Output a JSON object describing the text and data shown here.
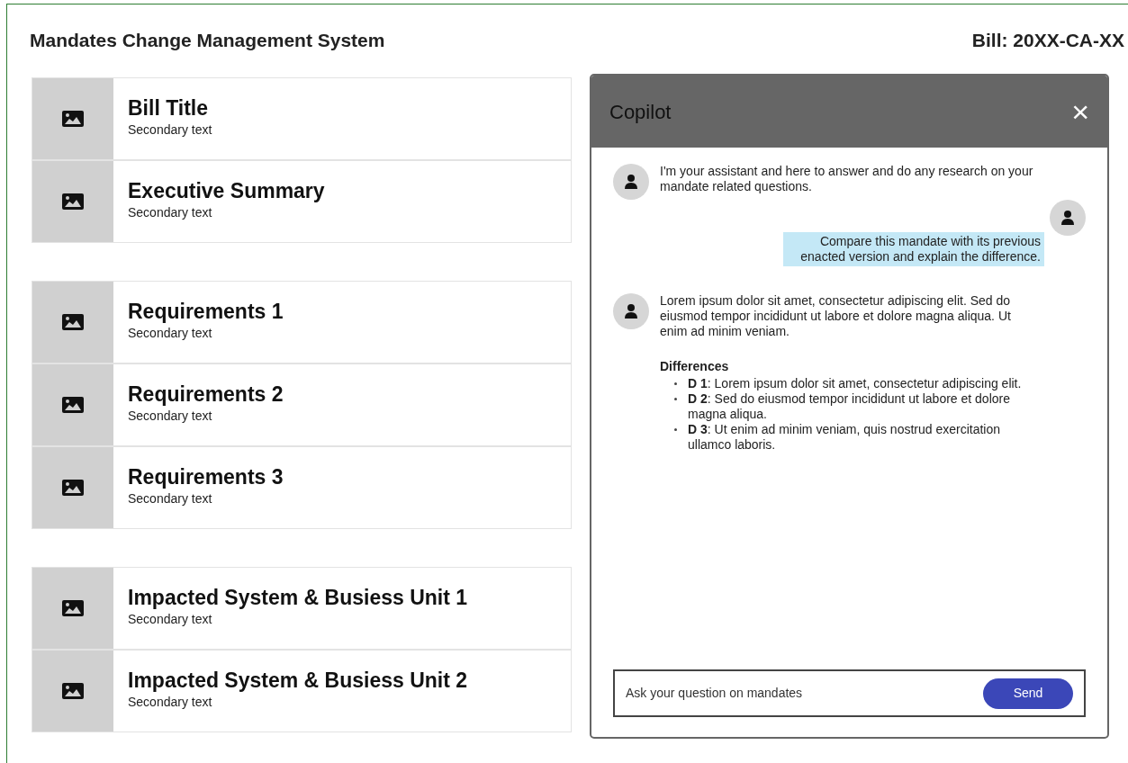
{
  "header": {
    "title": "Mandates Change Management System",
    "bill": "Bill: 20XX-CA-XX"
  },
  "groups": [
    {
      "items": [
        {
          "title": "Bill Title",
          "secondary": "Secondary text"
        },
        {
          "title": "Executive Summary",
          "secondary": "Secondary text"
        }
      ]
    },
    {
      "items": [
        {
          "title": "Requirements 1",
          "secondary": "Secondary text"
        },
        {
          "title": "Requirements 2",
          "secondary": "Secondary text"
        },
        {
          "title": "Requirements 3",
          "secondary": "Secondary text"
        }
      ]
    },
    {
      "items": [
        {
          "title": "Impacted System & Busiess Unit 1",
          "secondary": "Secondary text"
        },
        {
          "title": "Impacted System & Busiess Unit 2",
          "secondary": "Secondary text"
        }
      ]
    }
  ],
  "copilot": {
    "title": "Copilot",
    "close": "×",
    "messages": [
      {
        "kind": "assistant",
        "text": "I'm your assistant and here to answer and do any research on your mandate related questions."
      },
      {
        "kind": "user",
        "text": "Compare this mandate with its previous enacted version and explain the difference."
      },
      {
        "kind": "assistant",
        "text": "Lorem ipsum dolor sit amet, consectetur adipiscing elit. Sed do eiusmod tempor incididunt ut labore et dolore magna aliqua. Ut enim ad minim veniam.",
        "list_title": "Differences",
        "list": [
          "**D 1**: Lorem ipsum dolor sit amet, consectetur adipiscing elit.",
          "**D 2**: Sed do eiusmod tempor incididunt ut labore et dolore magna aliqua.",
          "**D 3**: Ut enim ad minim veniam, quis nostrud exercitation ullamco laboris."
        ]
      }
    ],
    "input": {
      "placeholder": "Ask your question on mandates"
    },
    "send": "Send"
  }
}
